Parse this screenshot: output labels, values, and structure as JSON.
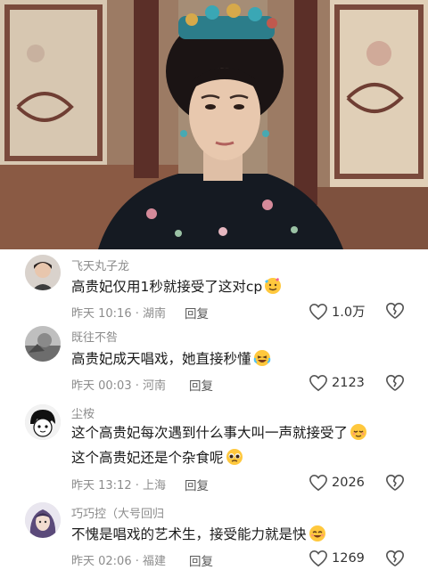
{
  "comments": [
    {
      "username": "飞天丸子龙",
      "lines": [
        "高贵妃仅用1秒就接受了这对cp"
      ],
      "emoji_icon": "face-with-hearts-emoji",
      "time": "昨天 10:16",
      "location": "湖南",
      "reply_label": "回复",
      "likes": "1.0万"
    },
    {
      "username": "既往不咎",
      "lines": [
        "高贵妃成天唱戏，她直接秒懂"
      ],
      "emoji_icon": "crying-laughing-emoji",
      "time": "昨天 00:03",
      "location": "河南",
      "reply_label": "回复",
      "likes": "2123"
    },
    {
      "username": "尘桉",
      "lines": [
        "这个高贵妃每次遇到什么事大叫一声就接受了",
        "这个高贵妃还是个杂食呢"
      ],
      "emoji_icon": "relieved-face-emoji",
      "emoji_icon_2": "pleading-face-emoji",
      "time": "昨天 13:12",
      "location": "上海",
      "reply_label": "回复",
      "likes": "2026"
    },
    {
      "username": "巧巧控（大号回归",
      "lines": [
        "不愧是唱戏的艺术生，接受能力就是快"
      ],
      "emoji_icon": "smiling-face-emoji",
      "time": "昨天 02:06",
      "location": "福建",
      "reply_label": "回复",
      "likes": "1269"
    }
  ],
  "colors": {
    "secondary_text": "#8c8c8c",
    "primary_text": "#1a1a1a",
    "emoji_yellow": "#ffc83d"
  }
}
